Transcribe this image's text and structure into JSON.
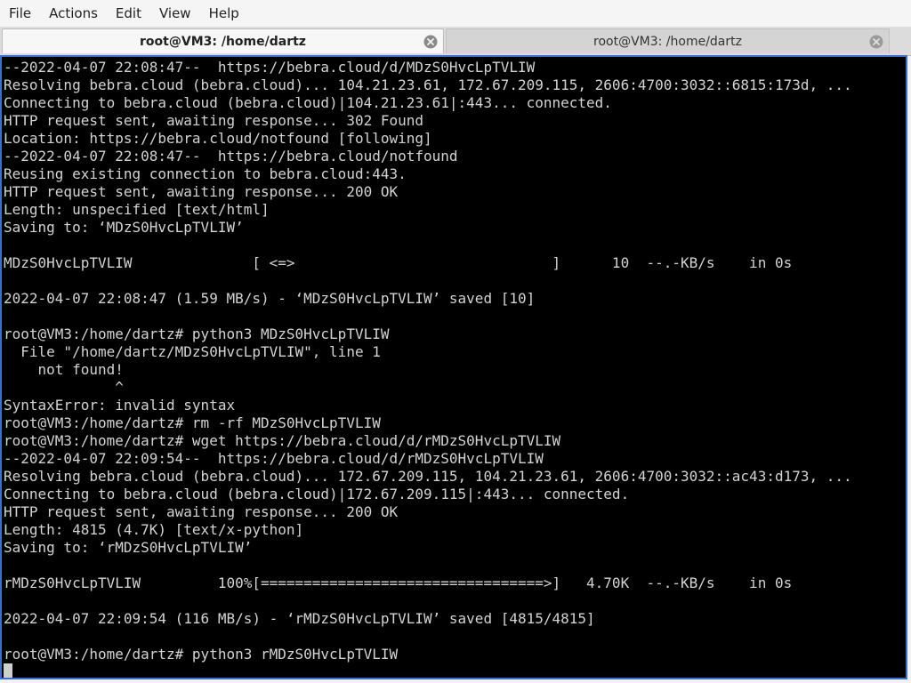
{
  "menubar": {
    "items": [
      "File",
      "Actions",
      "Edit",
      "View",
      "Help"
    ]
  },
  "tabs": [
    {
      "title": "root@VM3: /home/dartz",
      "active": true
    },
    {
      "title": "root@VM3: /home/dartz",
      "active": false
    }
  ],
  "terminal": {
    "lines": [
      "--2022-04-07 22:08:47--  https://bebra.cloud/d/MDzS0HvcLpTVLIW",
      "Resolving bebra.cloud (bebra.cloud)... 104.21.23.61, 172.67.209.115, 2606:4700:3032::6815:173d, ...",
      "Connecting to bebra.cloud (bebra.cloud)|104.21.23.61|:443... connected.",
      "HTTP request sent, awaiting response... 302 Found",
      "Location: https://bebra.cloud/notfound [following]",
      "--2022-04-07 22:08:47--  https://bebra.cloud/notfound",
      "Reusing existing connection to bebra.cloud:443.",
      "HTTP request sent, awaiting response... 200 OK",
      "Length: unspecified [text/html]",
      "Saving to: ‘MDzS0HvcLpTVLIW’",
      "",
      "MDzS0HvcLpTVLIW              [ <=>                              ]      10  --.-KB/s    in 0s",
      "",
      "2022-04-07 22:08:47 (1.59 MB/s) - ‘MDzS0HvcLpTVLIW’ saved [10]",
      "",
      "root@VM3:/home/dartz# python3 MDzS0HvcLpTVLIW",
      "  File \"/home/dartz/MDzS0HvcLpTVLIW\", line 1",
      "    not found!",
      "             ^",
      "SyntaxError: invalid syntax",
      "root@VM3:/home/dartz# rm -rf MDzS0HvcLpTVLIW",
      "root@VM3:/home/dartz# wget https://bebra.cloud/d/rMDzS0HvcLpTVLIW",
      "--2022-04-07 22:09:54--  https://bebra.cloud/d/rMDzS0HvcLpTVLIW",
      "Resolving bebra.cloud (bebra.cloud)... 172.67.209.115, 104.21.23.61, 2606:4700:3032::ac43:d173, ...",
      "Connecting to bebra.cloud (bebra.cloud)|172.67.209.115|:443... connected.",
      "HTTP request sent, awaiting response... 200 OK",
      "Length: 4815 (4.7K) [text/x-python]",
      "Saving to: ‘rMDzS0HvcLpTVLIW’",
      "",
      "rMDzS0HvcLpTVLIW         100%[=================================>]   4.70K  --.-KB/s    in 0s",
      "",
      "2022-04-07 22:09:54 (116 MB/s) - ‘rMDzS0HvcLpTVLIW’ saved [4815/4815]",
      "",
      "root@VM3:/home/dartz# python3 rMDzS0HvcLpTVLIW"
    ]
  },
  "colors": {
    "terminal_bg": "#000000",
    "terminal_fg": "#d3d3d3",
    "focus_border": "#3d6fc7"
  }
}
